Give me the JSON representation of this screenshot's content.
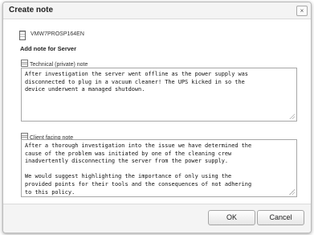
{
  "dialog": {
    "title": "Create note",
    "close_label": "×"
  },
  "server": {
    "icon": "server-icon",
    "name": "VMW7PROSP164EN"
  },
  "section_heading": "Add note for Server",
  "technical_note": {
    "icon": "note-icon",
    "label": "Technical (private) note",
    "value": "After investigation the server went offline as the power supply was\ndisconnected to plug in a vacuum cleaner! The UPS kicked in so the\ndevice underwent a managed shutdown."
  },
  "client_note": {
    "icon": "note-icon",
    "label": "Client facing note",
    "value": "After a thorough investigation into the issue we have determined the\ncause of the problem was initiated by one of the cleaning crew\ninadvertently disconnecting the server from the power supply.\n\nWe would suggest highlighting the importance of only using the\nprovided points for their tools and the consequences of not adhering\nto this policy."
  },
  "buttons": {
    "ok_label": "OK",
    "cancel_label": "Cancel"
  }
}
